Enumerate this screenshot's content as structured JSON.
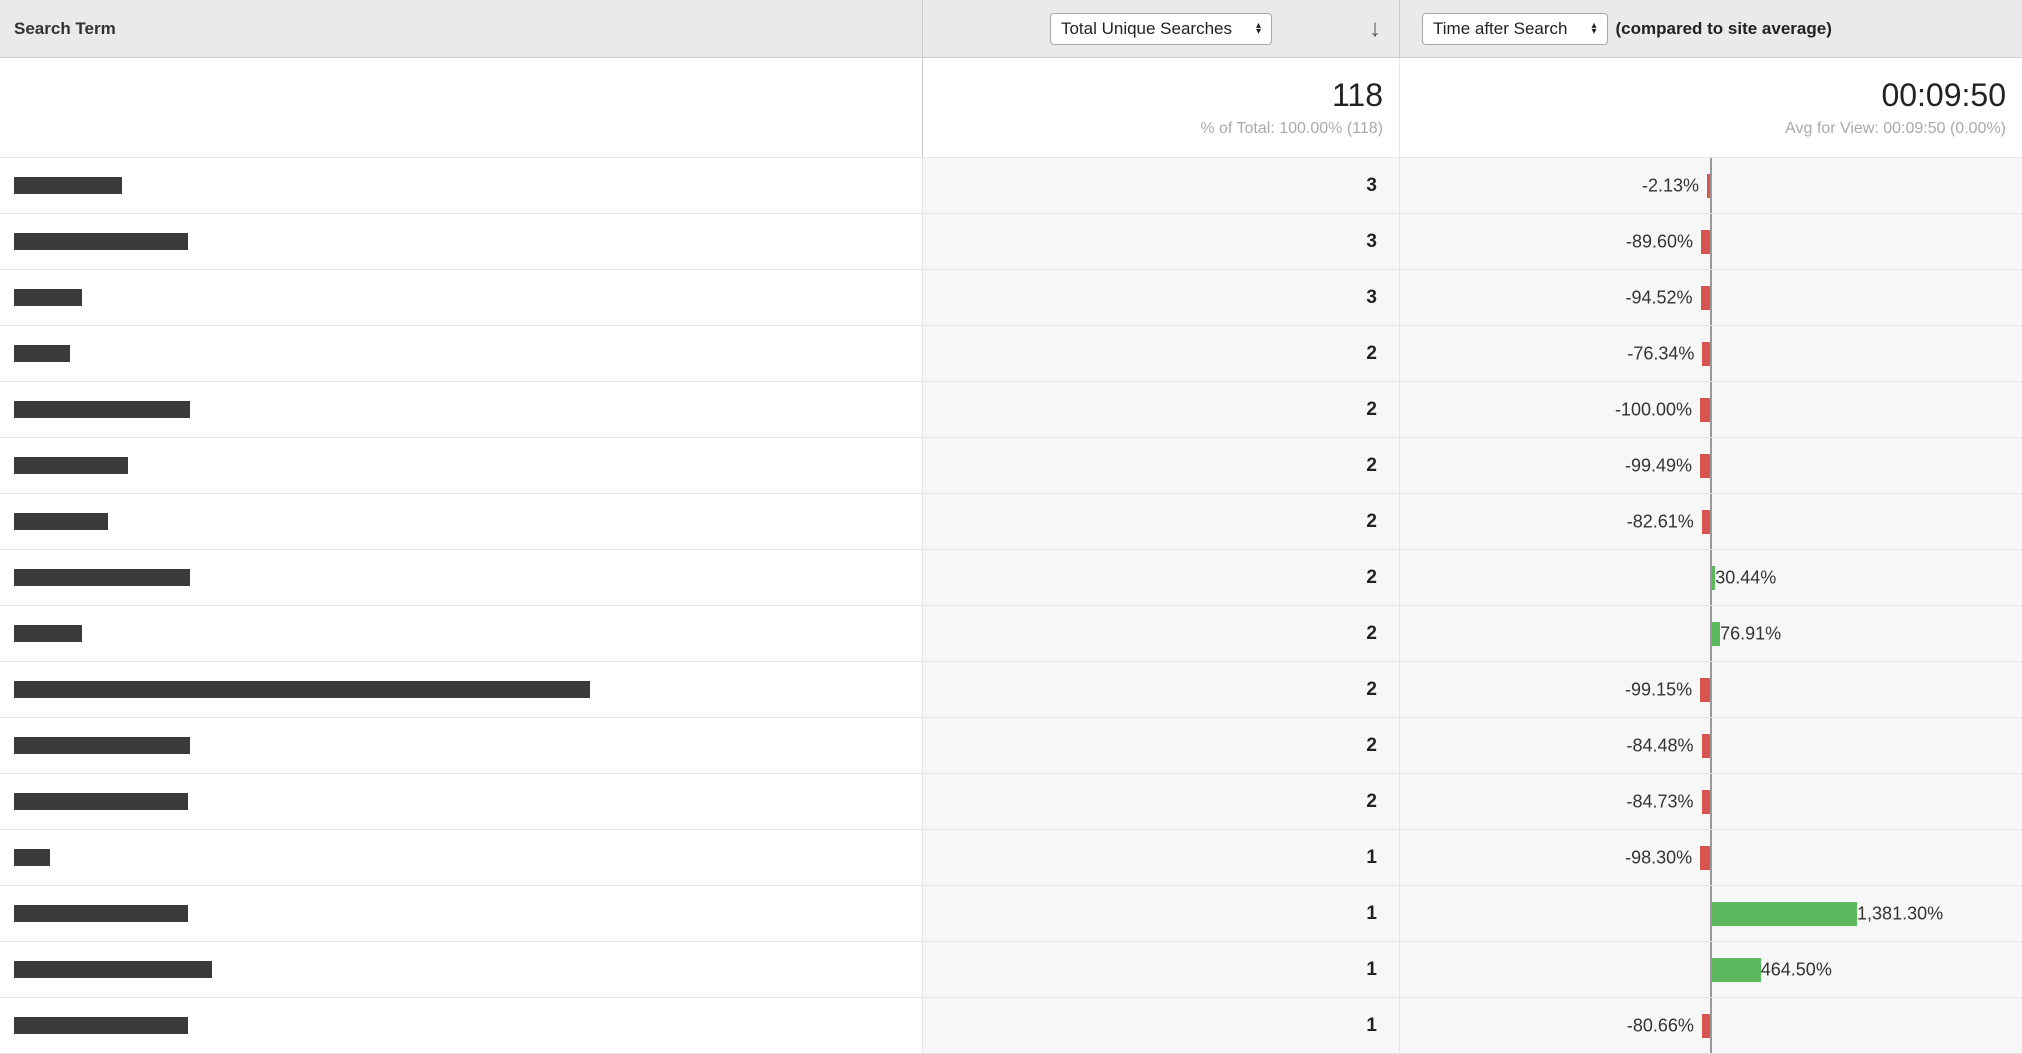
{
  "header": {
    "term_label": "Search Term",
    "searches_select": "Total Unique Searches",
    "time_select": "Time after Search",
    "compared_label": "(compared to site average)"
  },
  "summary": {
    "searches_total": "118",
    "searches_sub": "% of Total: 100.00% (118)",
    "time_total": "00:09:50",
    "time_sub": "Avg for View: 00:09:50 (0.00%)"
  },
  "chart_data": {
    "type": "bar",
    "title": "Time after Search (compared to site average)",
    "xlabel": "% vs site average",
    "ylabel": "Search Term",
    "series": [
      {
        "name": "Total Unique Searches",
        "values": [
          3,
          3,
          3,
          2,
          2,
          2,
          2,
          2,
          2,
          2,
          2,
          2,
          1,
          1,
          1,
          1
        ]
      },
      {
        "name": "Time after Search % vs avg",
        "values": [
          -2.13,
          -89.6,
          -94.52,
          -76.34,
          -100.0,
          -99.49,
          -82.61,
          30.44,
          76.91,
          -99.15,
          -84.48,
          -84.73,
          -98.3,
          1381.3,
          464.5,
          -80.66
        ]
      }
    ],
    "categories": [
      "(redacted)",
      "(redacted)",
      "(redacted)",
      "(redacted)",
      "(redacted)",
      "(redacted)",
      "(redacted)",
      "(redacted)",
      "(redacted)",
      "(redacted)",
      "(redacted)",
      "(redacted)",
      "(redacted)",
      "(redacted)",
      "(redacted)",
      "(redacted)"
    ]
  },
  "rows": [
    {
      "redact_w": 108,
      "searches": "3",
      "pct": -2.13,
      "label": "-2.13%"
    },
    {
      "redact_w": 174,
      "searches": "3",
      "pct": -89.6,
      "label": "-89.60%"
    },
    {
      "redact_w": 68,
      "searches": "3",
      "pct": -94.52,
      "label": "-94.52%"
    },
    {
      "redact_w": 56,
      "searches": "2",
      "pct": -76.34,
      "label": "-76.34%"
    },
    {
      "redact_w": 176,
      "searches": "2",
      "pct": -100.0,
      "label": "-100.00%"
    },
    {
      "redact_w": 114,
      "searches": "2",
      "pct": -99.49,
      "label": "-99.49%"
    },
    {
      "redact_w": 94,
      "searches": "2",
      "pct": -82.61,
      "label": "-82.61%"
    },
    {
      "redact_w": 176,
      "searches": "2",
      "pct": 30.44,
      "label": "30.44%"
    },
    {
      "redact_w": 68,
      "searches": "2",
      "pct": 76.91,
      "label": "76.91%"
    },
    {
      "redact_w": 576,
      "searches": "2",
      "pct": -99.15,
      "label": "-99.15%"
    },
    {
      "redact_w": 176,
      "searches": "2",
      "pct": -84.48,
      "label": "-84.48%"
    },
    {
      "redact_w": 174,
      "searches": "2",
      "pct": -84.73,
      "label": "-84.73%"
    },
    {
      "redact_w": 36,
      "searches": "1",
      "pct": -98.3,
      "label": "-98.30%"
    },
    {
      "redact_w": 174,
      "searches": "1",
      "pct": 1381.3,
      "label": "1,381.30%"
    },
    {
      "redact_w": 198,
      "searches": "1",
      "pct": 464.5,
      "label": "464.50%"
    },
    {
      "redact_w": 174,
      "searches": "1",
      "pct": -80.66,
      "label": "-80.66%"
    }
  ]
}
